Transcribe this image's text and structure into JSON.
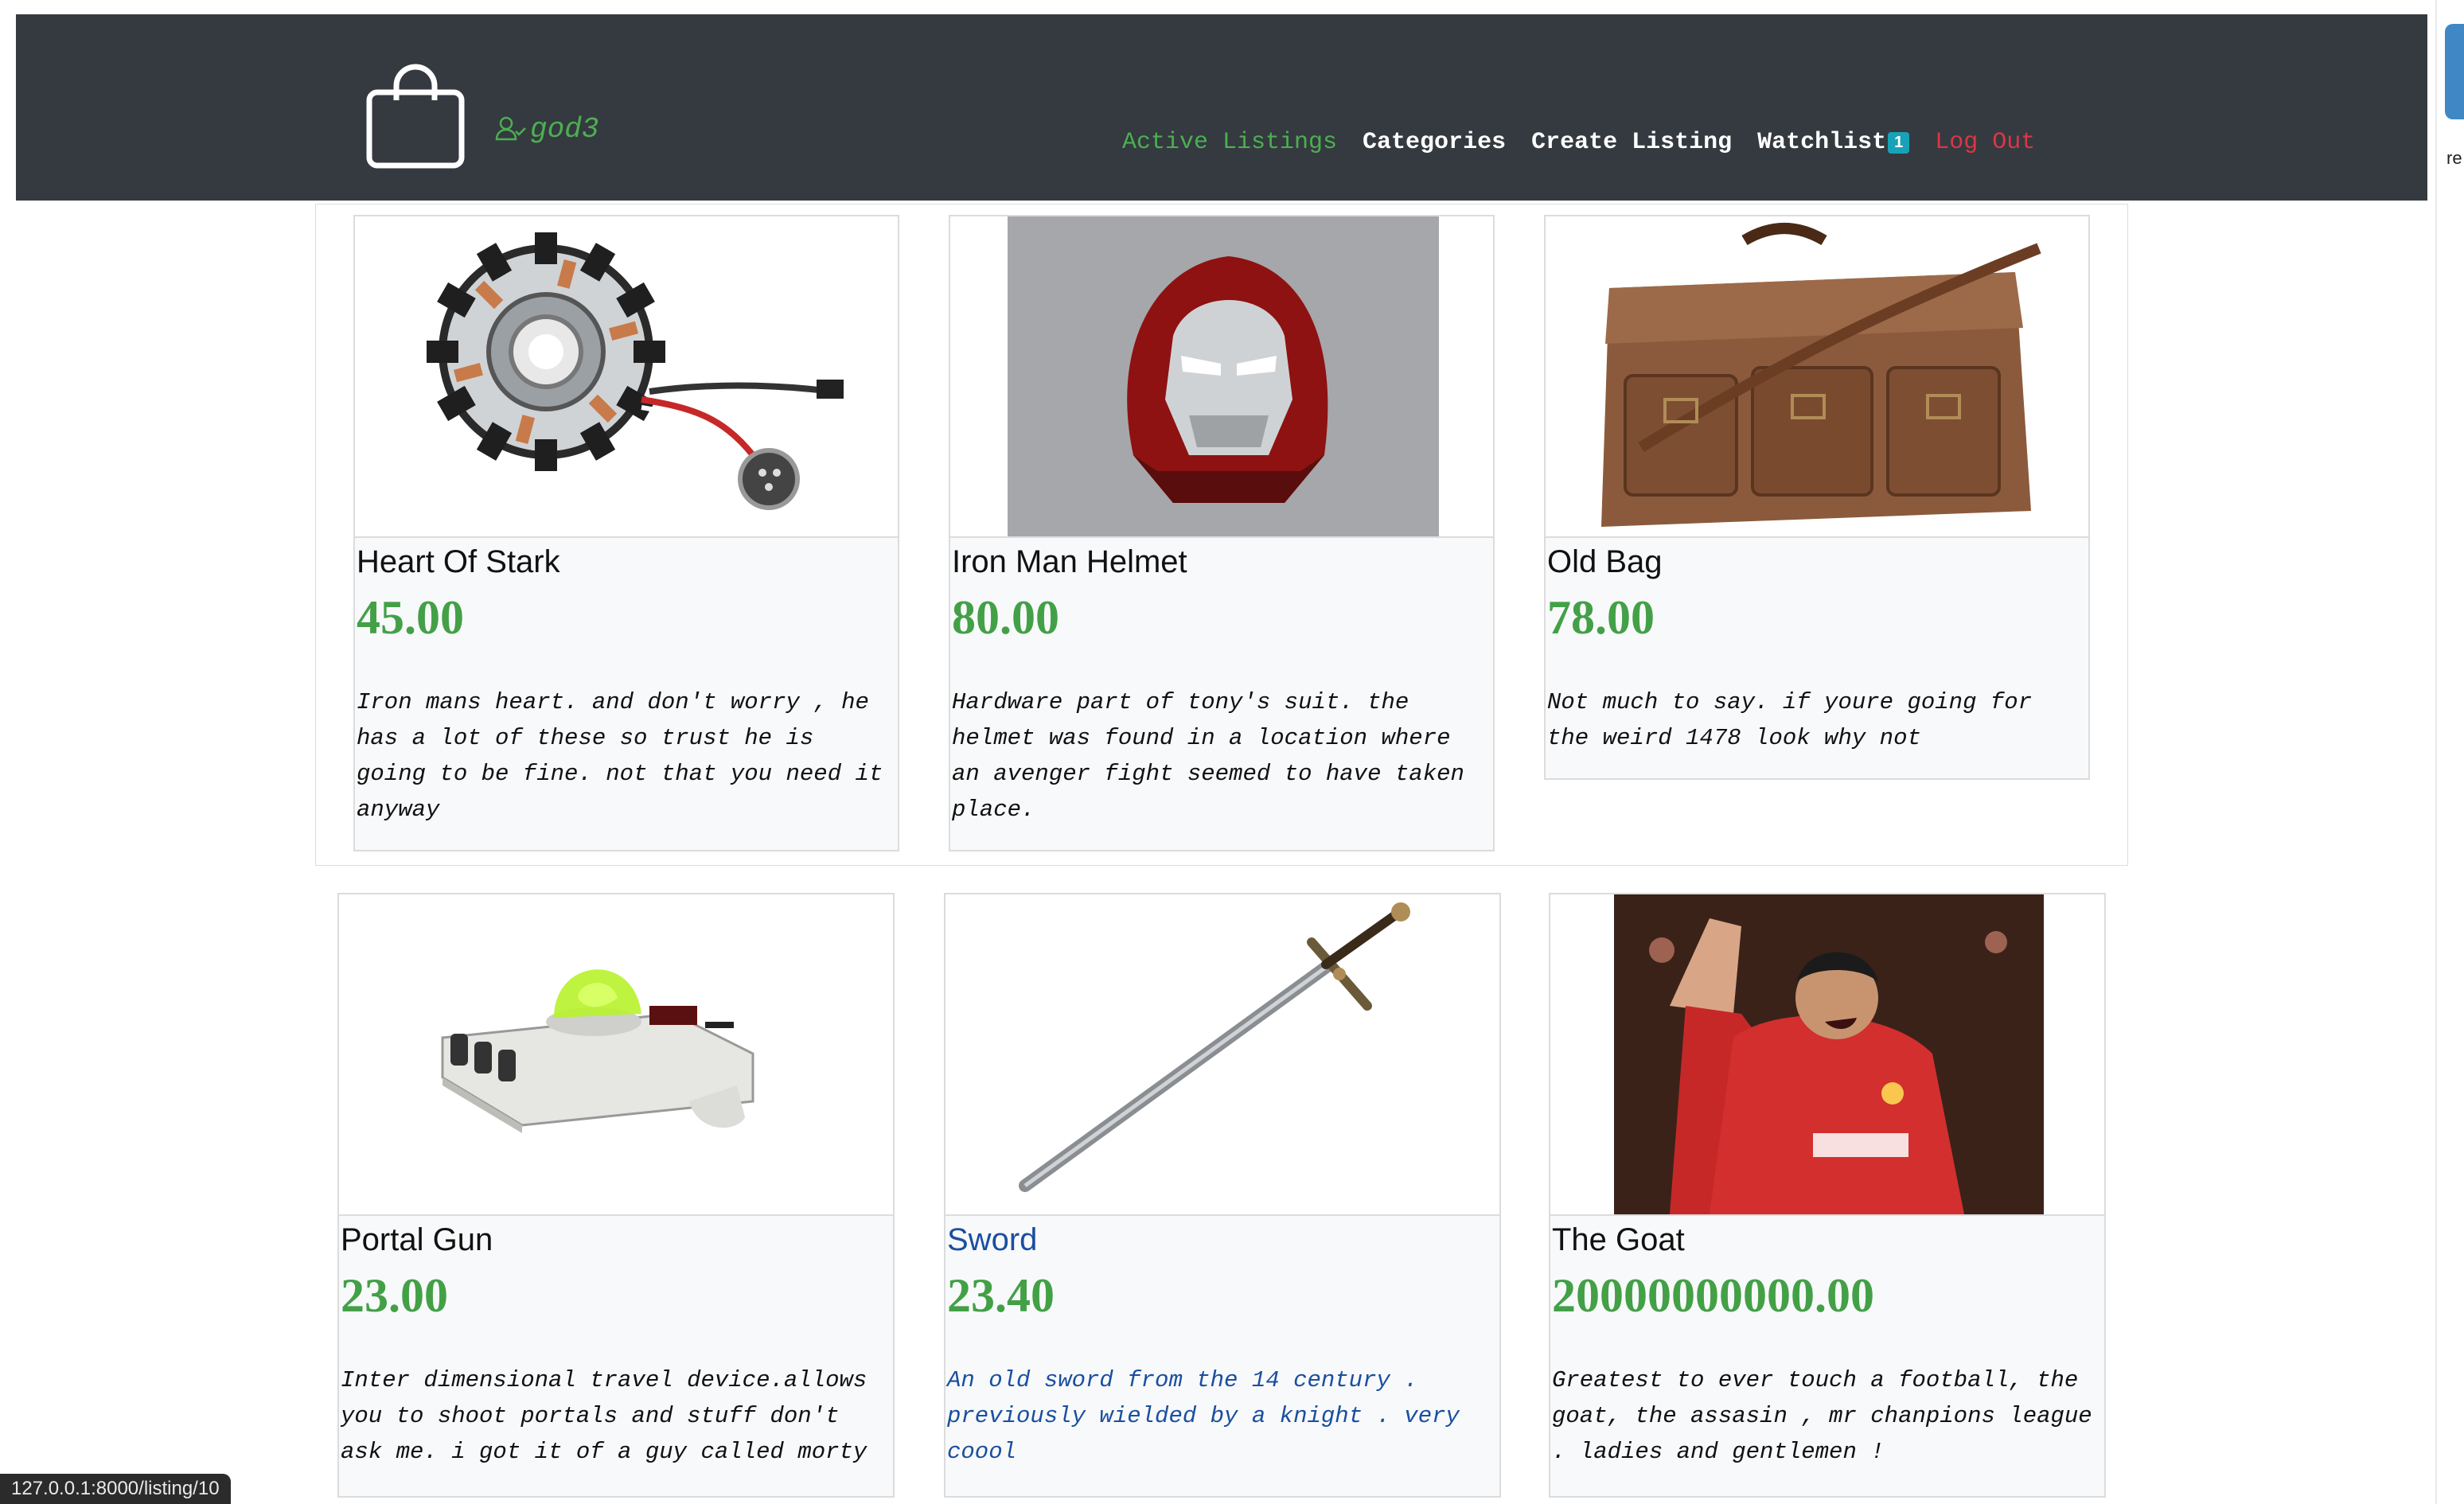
{
  "navbar": {
    "username": "god3",
    "links": {
      "active_listings": "Active Listings",
      "categories": "Categories",
      "create_listing": "Create Listing",
      "watchlist": "Watchlist",
      "watchlist_count": "1",
      "logout": "Log Out"
    }
  },
  "listings": [
    {
      "title": "Heart Of Stark",
      "price": "45.00",
      "description": "Iron mans heart. and don't worry , he has a lot of these so trust he is going to be fine. not that you need it anyway"
    },
    {
      "title": "Iron Man Helmet",
      "price": "80.00",
      "description": "Hardware part of tony's suit. the helmet was found in a location where an avenger fight seemed to have taken place."
    },
    {
      "title": "Old Bag",
      "price": "78.00",
      "description": "Not much to say. if youre going for the weird 1478 look why not"
    },
    {
      "title": "Portal Gun",
      "price": "23.00",
      "description": "Inter dimensional travel device.allows you to shoot portals and stuff don't ask me. i got it of a guy called morty"
    },
    {
      "title": "Sword",
      "price": "23.40",
      "description": "An old sword from the 14 century . previously wielded by a knight . very coool"
    },
    {
      "title": "The Goat",
      "price": "20000000000.00",
      "description": "Greatest to ever touch a football, the goat, the assasin , mr chanpions league . ladies and gentlemen !"
    }
  ],
  "status_bar": {
    "url": "127.0.0.1:8000/listing/10"
  },
  "colors": {
    "navbar_bg": "#343a40",
    "price_green": "#43a047",
    "active_link": "#4caf50",
    "logout_red": "#dc3545",
    "badge": "#17a2b8",
    "link_blue": "#1a4fa0"
  }
}
